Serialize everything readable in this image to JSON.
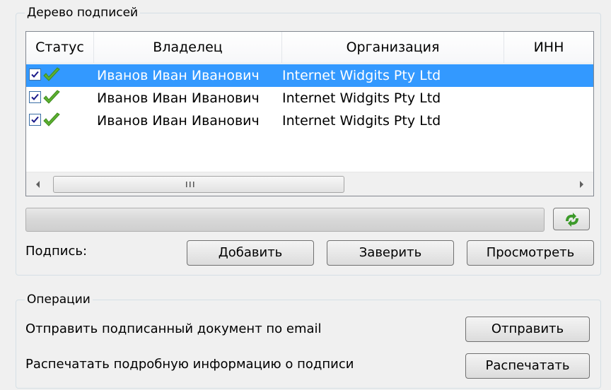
{
  "signatures_group": {
    "title": "Дерево подписей",
    "columns": [
      "Статус",
      "Владелец",
      "Организация",
      "ИНН"
    ],
    "rows": [
      {
        "owner": "Иванов Иван Иванович",
        "organization": "Internet Widgits Pty Ltd",
        "checked": true,
        "status": "valid",
        "selected": true
      },
      {
        "owner": "Иванов Иван Иванович",
        "organization": "Internet Widgits Pty Ltd",
        "checked": true,
        "status": "valid",
        "selected": false
      },
      {
        "owner": "Иванов Иван Иванович",
        "organization": "Internet Widgits Pty Ltd",
        "checked": true,
        "status": "valid",
        "selected": false
      }
    ],
    "hscroll_grip": "III",
    "progress_fraction": 0,
    "refresh_icon": "refresh-arrows-icon",
    "signature_label": "Подпись:",
    "add_button": "Добавить",
    "certify_button": "Заверить",
    "view_button": "Просмотреть"
  },
  "operations_group": {
    "title": "Операции",
    "email_text": "Отправить подписанный документ по email",
    "send_button": "Отправить",
    "print_text": "Распечатать подробную информацию о подписи",
    "print_button": "Распечатать"
  },
  "colors": {
    "selection": "#3399ff",
    "valid_check": "#5cb030",
    "refresh_icon": "#3c9a2a"
  }
}
